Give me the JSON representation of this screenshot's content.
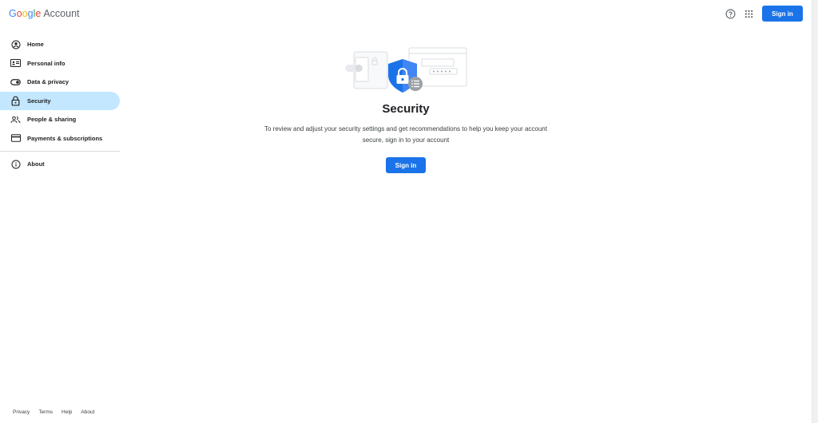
{
  "header": {
    "logo_letters": [
      "G",
      "o",
      "o",
      "g",
      "l",
      "e"
    ],
    "logo_suffix": "Account",
    "help_icon": "help-circle-icon",
    "apps_icon": "apps-grid-icon",
    "sign_in_label": "Sign in"
  },
  "sidebar": {
    "items": [
      {
        "label": "Home",
        "icon": "account-circle-icon",
        "active": false
      },
      {
        "label": "Personal info",
        "icon": "id-card-icon",
        "active": false
      },
      {
        "label": "Data & privacy",
        "icon": "toggle-icon",
        "active": false
      },
      {
        "label": "Security",
        "icon": "lock-icon",
        "active": true
      },
      {
        "label": "People & sharing",
        "icon": "people-icon",
        "active": false
      },
      {
        "label": "Payments & subscriptions",
        "icon": "credit-card-icon",
        "active": false
      }
    ],
    "about": {
      "label": "About",
      "icon": "info-icon"
    }
  },
  "main": {
    "title": "Security",
    "description": "To review and adjust your security settings and get recommendations to help you keep your account secure, sign in to your account",
    "sign_in_label": "Sign in"
  },
  "footer": {
    "links": [
      "Privacy",
      "Terms",
      "Help",
      "About"
    ]
  },
  "colors": {
    "primary": "#1a73e8",
    "active_nav": "#c2e7ff",
    "text": "#202124"
  }
}
